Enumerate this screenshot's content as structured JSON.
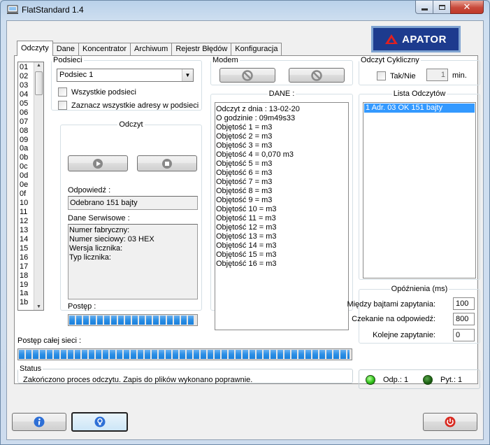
{
  "window": {
    "title": "FlatStandard 1.4",
    "controls": {
      "minimize": "minimize-icon",
      "maximize": "maximize-icon",
      "close": "close-icon"
    }
  },
  "logo": {
    "text": "APATOR"
  },
  "tabs": [
    {
      "label": "Odczyty",
      "active": true
    },
    {
      "label": "Dane"
    },
    {
      "label": "Koncentrator"
    },
    {
      "label": "Archiwum"
    },
    {
      "label": "Rejestr Błędów"
    },
    {
      "label": "Konfiguracja"
    }
  ],
  "address_list": [
    "01",
    "02",
    "03",
    "04",
    "05",
    "06",
    "07",
    "08",
    "09",
    "0a",
    "0b",
    "0c",
    "0d",
    "0e",
    "0f",
    "10",
    "11",
    "12",
    "13",
    "14",
    "15",
    "16",
    "17",
    "18",
    "19",
    "1a",
    "1b"
  ],
  "podsieci": {
    "title": "Podsieci",
    "selected": "Podsiec 1",
    "all_subnets_label": "Wszystkie podsieci",
    "mark_all_label": "Zaznacz wszystkie adresy w podsieci"
  },
  "odczyt": {
    "title": "Odczyt",
    "play_icon": "play-icon",
    "stop_icon": "stop-icon",
    "response_label": "Odpowiedź :",
    "response_value": "Odebrano 151 bajty",
    "service_label": "Dane Serwisowe :",
    "service_lines": [
      "Numer fabryczny:",
      "Numer sieciowy: 03 HEX",
      "Wersja licznika:",
      "Typ licznika:"
    ],
    "progress_label": "Postęp :",
    "progress_value": 100
  },
  "modem": {
    "title": "Modem",
    "connect_icon": "connect-icon",
    "disconnect_icon": "disconnect-icon"
  },
  "dane": {
    "title": "DANE :",
    "lines": [
      "Odczyt z dnia : 13-02-20",
      "O godzinie : 09m49s33",
      "Objętość 1 =  m3",
      "Objętość 2 =  m3",
      "Objętość 3 =  m3",
      "Objętość 4 = 0,070 m3",
      "Objętość 5 =  m3",
      "Objętość 6 =  m3",
      "Objętość 7 =  m3",
      "Objętość 8 =  m3",
      "Objętość 9 =  m3",
      "Objętość 10 =  m3",
      "Objętość 11 =  m3",
      "Objętość 12 =  m3",
      "Objętość 13 =  m3",
      "Objętość 14 =  m3",
      "Objętość 15 =  m3",
      "Objętość 16 =  m3"
    ]
  },
  "cyclic": {
    "title": "Odczyt Cykliczny",
    "checkbox_label": "Tak/Nie",
    "interval": "1",
    "unit": "min."
  },
  "readings_list": {
    "title": "Lista Odczytów",
    "items": [
      "1 Adr. 03 OK 151 bajty"
    ]
  },
  "delays": {
    "title": "Opóźnienia (ms)",
    "between_bytes_label": "Między bajtami zapytania:",
    "between_bytes": "100",
    "wait_label": "Czekanie na odpowiedź:",
    "wait": "800",
    "next_label": "Kolejne zapytanie:",
    "next": "0"
  },
  "network_progress": {
    "label": "Postęp całej sieci :",
    "value": 100
  },
  "status": {
    "title": "Status",
    "text": "Zakończono proces odczytu. Zapis do plików wykonano poprawnie."
  },
  "counters": {
    "responses_label": "Odp.: 1",
    "queries_label": "Pyt.: 1"
  },
  "bottom": {
    "info_icon": "info-icon",
    "help_icon": "lightbulb-icon",
    "power_icon": "power-icon"
  },
  "colors": {
    "progress": "#2a8fe6",
    "selection": "#3399ff",
    "logo_bg": "#1d3b8e",
    "led_on": "#2fc21a"
  }
}
